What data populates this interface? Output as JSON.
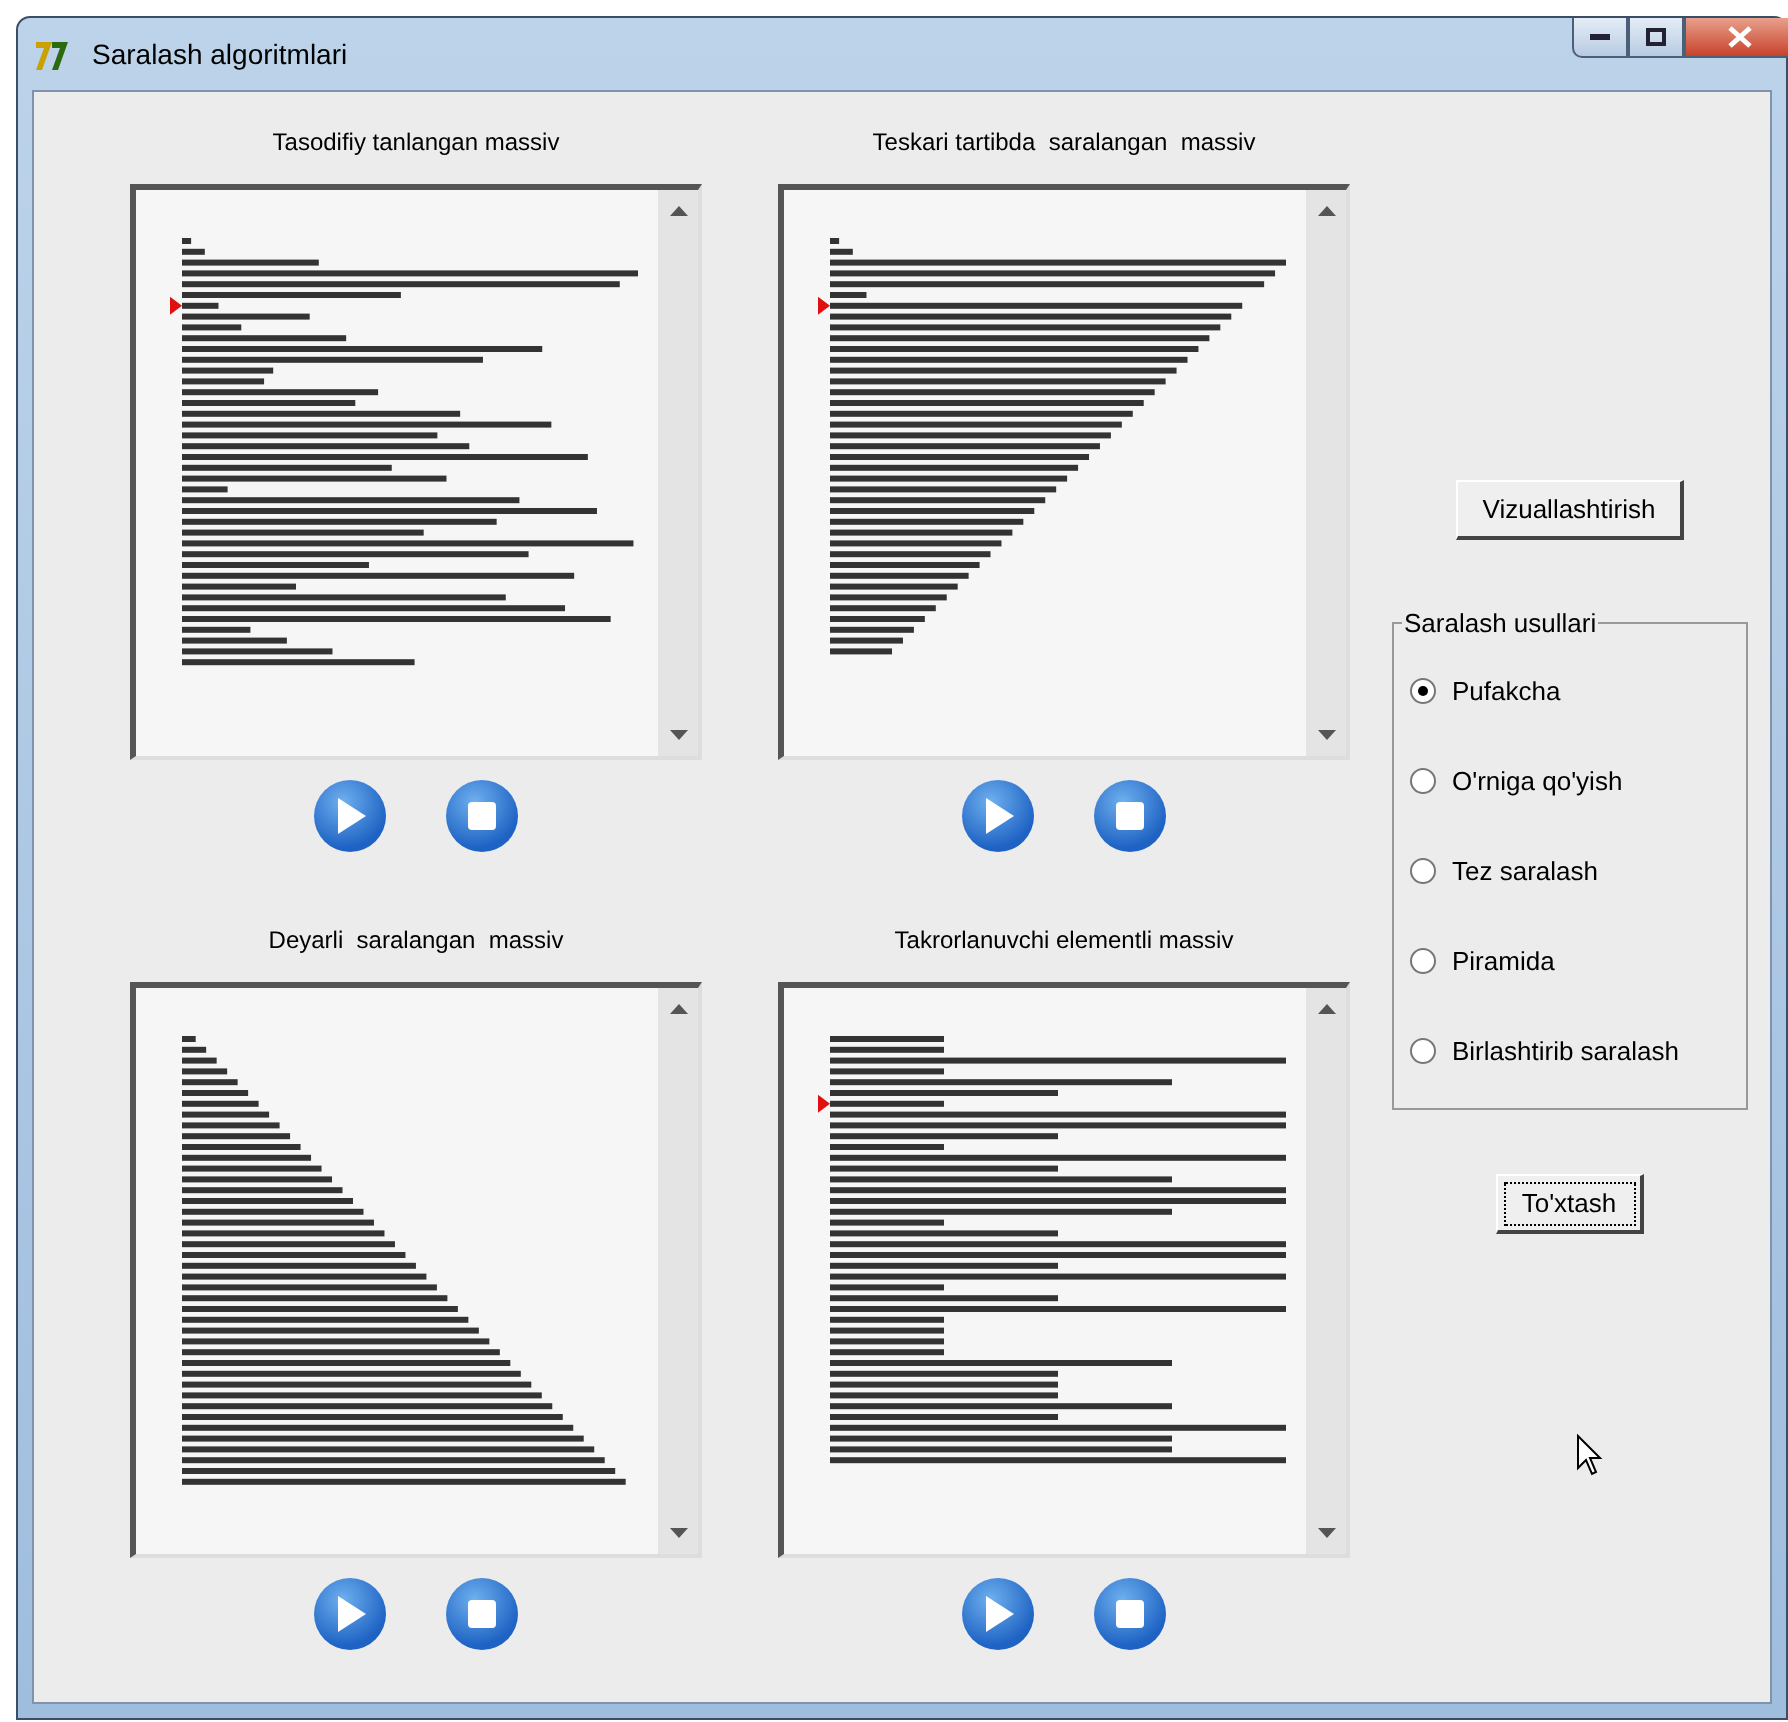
{
  "window": {
    "title": "Saralash algoritmlari"
  },
  "panels": [
    {
      "title": "Tasodifiy tanlangan massiv",
      "kind": "random",
      "marker": true
    },
    {
      "title": "Teskari tartibda  saralangan  massiv",
      "kind": "reverse",
      "marker": true
    },
    {
      "title": "Deyarli  saralangan  massiv",
      "kind": "nearly",
      "marker": false
    },
    {
      "title": "Takrorlanuvchi elementli massiv",
      "kind": "repeated",
      "marker": true
    }
  ],
  "visualize_button": "Vizuallashtirish",
  "methods": {
    "title": "Saralash usullari",
    "options": [
      {
        "label": "Pufakcha",
        "selected": true
      },
      {
        "label": "O'rniga qo'yish",
        "selected": false
      },
      {
        "label": "Tez saralash",
        "selected": false
      },
      {
        "label": "Piramida",
        "selected": false
      },
      {
        "label": "Birlashtirib saralash",
        "selected": false
      }
    ]
  },
  "stop_button": "To'xtash"
}
